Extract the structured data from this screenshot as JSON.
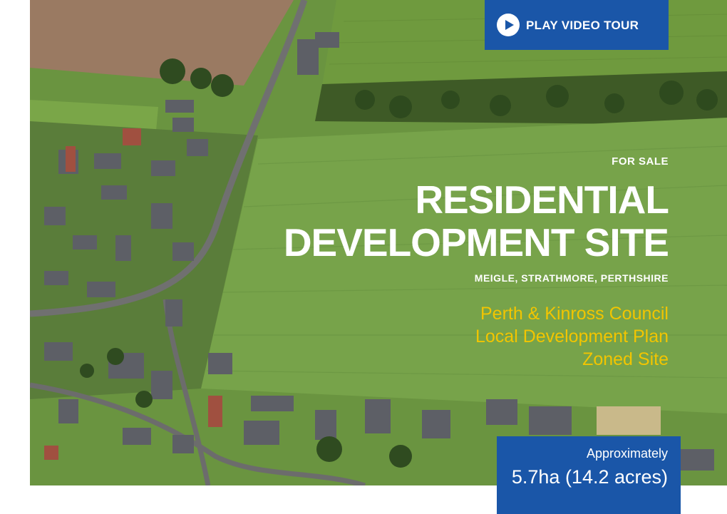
{
  "video_button": {
    "label": "PLAY VIDEO TOUR",
    "icon": "play-icon"
  },
  "listing": {
    "status": "FOR SALE",
    "title_line1": "RESIDENTIAL",
    "title_line2": "DEVELOPMENT SITE",
    "location": "MEIGLE, STRATHMORE, PERTHSHIRE",
    "council_line1": "Perth & Kinross Council",
    "council_line2": "Local Development Plan",
    "council_line3": "Zoned Site"
  },
  "area": {
    "prefix": "Approximately",
    "value": "5.7ha (14.2 acres)"
  },
  "colors": {
    "brand_blue": "#1a56a8",
    "accent_yellow": "#f2c500",
    "text_white": "#ffffff"
  }
}
